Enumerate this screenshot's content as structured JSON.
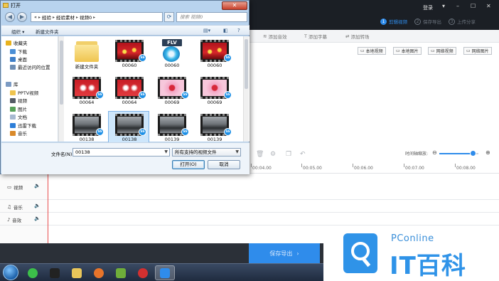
{
  "app": {
    "login_label": "登录",
    "window_controls": [
      "▾",
      "–",
      "☐",
      "✕"
    ],
    "steps": [
      {
        "num": "1",
        "label": "剪辑视频",
        "active": true
      },
      {
        "num": "2",
        "label": "保存导出",
        "active": false
      },
      {
        "num": "3",
        "label": "上传分享",
        "active": false
      }
    ],
    "tool_tabs": [
      {
        "icon": "≋",
        "label": "添加音效"
      },
      {
        "icon": "T",
        "label": "添加字幕"
      },
      {
        "icon": "⇄",
        "label": "添加转场"
      }
    ],
    "media_buttons": [
      "本地视频",
      "本地图片",
      "网络视频",
      "网络图片"
    ],
    "timeline": {
      "zoom_label": "时间轴缩放:",
      "zoom_level": 0.85,
      "ruler_labels": [
        "00:04.00",
        "00:05.00",
        "00:06.00",
        "00:07.00",
        "00:08.00"
      ],
      "tracks": [
        {
          "icon": "▭",
          "label": "视频"
        },
        {
          "icon": "♫",
          "label": "音乐"
        },
        {
          "icon": "♪",
          "label": "音效"
        }
      ]
    },
    "export_label": "保存导出",
    "accent_color": "#2f8ceb"
  },
  "watermark": {
    "brand": "PConline",
    "name": "IT百科"
  },
  "dialog": {
    "title": "打开",
    "close_icon": "✕",
    "breadcrumbs": [
      "«",
      "经验",
      "经验素材",
      "视频0"
    ],
    "search_placeholder": "搜索 视频0",
    "toolbar": {
      "organize": "组织 ▾",
      "new_folder": "新建文件夹"
    },
    "nav_pane": [
      {
        "label": "收藏夹",
        "icon": "star-icon",
        "indent": 0
      },
      {
        "label": "下载",
        "icon": "download-icon",
        "indent": 1
      },
      {
        "label": "桌面",
        "icon": "desktop-icon",
        "indent": 1
      },
      {
        "label": "最近访问的位置",
        "icon": "recent-icon",
        "indent": 1
      },
      {
        "label": "库",
        "icon": "library-icon",
        "indent": 0
      },
      {
        "label": "PPTV视频",
        "icon": "folder-icon",
        "indent": 1
      },
      {
        "label": "视频",
        "icon": "video-icon",
        "indent": 1
      },
      {
        "label": "图片",
        "icon": "picture-icon",
        "indent": 1
      },
      {
        "label": "文档",
        "icon": "document-icon",
        "indent": 1
      },
      {
        "label": "迅雷下载",
        "icon": "thunder-icon",
        "indent": 1
      },
      {
        "label": "音乐",
        "icon": "music-icon",
        "indent": 1
      }
    ],
    "files": [
      {
        "name": "新建文件夹",
        "kind": "folder",
        "selected": false
      },
      {
        "name": "00060",
        "kind": "video-red",
        "selected": false
      },
      {
        "name": "00060",
        "kind": "flv",
        "selected": false
      },
      {
        "name": "00060",
        "kind": "video-red",
        "selected": false
      },
      {
        "name": "00064",
        "kind": "video-red2",
        "selected": false
      },
      {
        "name": "00064",
        "kind": "video-red2",
        "selected": false
      },
      {
        "name": "00069",
        "kind": "video-pink",
        "selected": false
      },
      {
        "name": "00069",
        "kind": "video-pink",
        "selected": false
      },
      {
        "name": "00138",
        "kind": "video-car",
        "selected": false
      },
      {
        "name": "00138",
        "kind": "video-car",
        "selected": true
      },
      {
        "name": "00139",
        "kind": "video-car",
        "selected": false
      },
      {
        "name": "00139",
        "kind": "video-car",
        "selected": false
      }
    ],
    "badge_text": "SS",
    "flv_text": "FLV",
    "filename_label": "文件名(N):",
    "filename_value": "00138",
    "filetype_value": "所有支持的视频文件",
    "open_button": "打开(O)",
    "cancel_button": "取消"
  },
  "taskbar": {
    "apps": [
      {
        "name": "360-app",
        "color": "#3cbf4a",
        "active": false
      },
      {
        "name": "qq-app",
        "color": "#222222",
        "active": false
      },
      {
        "name": "explorer-app",
        "color": "#e9c65a",
        "active": false
      },
      {
        "name": "firefox-app",
        "color": "#e8742a",
        "active": false
      },
      {
        "name": "media-app",
        "color": "#6fae3a",
        "active": false
      },
      {
        "name": "record-app",
        "color": "#d23030",
        "active": false
      },
      {
        "name": "editor-app",
        "color": "#2f8ceb",
        "active": true
      }
    ]
  }
}
